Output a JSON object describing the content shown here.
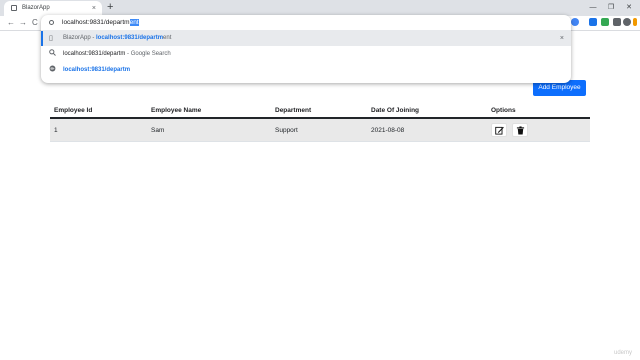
{
  "browser": {
    "tab_title": "BlazorApp",
    "tab_close": "×",
    "new_tab": "+",
    "window_controls": [
      "—",
      "❐",
      "✕"
    ],
    "nav": {
      "back": "←",
      "forward": "→",
      "reload": "C"
    },
    "address": {
      "typed": "localhost:9831/departm",
      "autocompleted": "ent"
    },
    "suggestions": [
      {
        "icon": "info",
        "prefix": "BlazorApp - ",
        "url": "localhost:9831/departm",
        "suffix": "ent",
        "remove": "×",
        "active": true
      },
      {
        "icon": "search",
        "text": "localhost:9831/departm",
        "secondary": " - Google Search"
      },
      {
        "icon": "globe",
        "url": "localhost:9831/departm"
      }
    ],
    "extension_colors": [
      "#4285f4",
      "#1a73e8",
      "#34a853",
      "#5f6368",
      "#5f6368",
      "#f29900"
    ]
  },
  "page": {
    "add_button_label": "Add Employee",
    "table": {
      "headers": [
        "Employee Id",
        "Employee Name",
        "Department",
        "Date Of Joining",
        "Options"
      ],
      "rows": [
        {
          "id": "1",
          "name": "Sam",
          "department": "Support",
          "date_of_joining": "2021-08-08"
        }
      ]
    },
    "option_icons": [
      "edit-icon",
      "delete-icon"
    ],
    "accent_color": "#0d6efd"
  },
  "watermark": "udemy"
}
